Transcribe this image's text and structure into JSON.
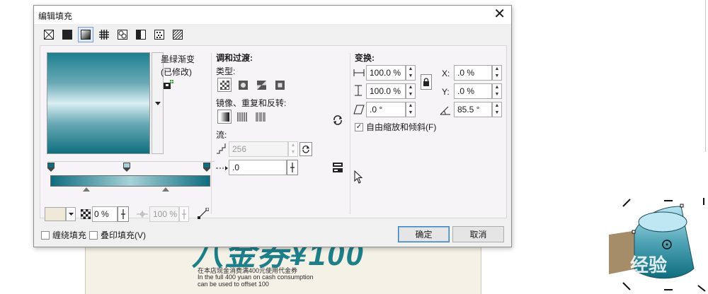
{
  "dialog": {
    "title": "编辑填充",
    "close_label": "✕"
  },
  "fill_types": [
    "none-fill-icon",
    "uniform-fill-icon",
    "fountain-fill-icon",
    "vector-pattern-icon",
    "bitmap-pattern-icon",
    "two-color-pattern-icon",
    "texture-fill-icon",
    "postscript-fill-icon"
  ],
  "preset": {
    "name": "墨绿渐变",
    "modified": "(已修改)"
  },
  "blend": {
    "header": "调和过渡:",
    "type_label": "类型:",
    "mirror_label": "镜像、重复和反转:",
    "flow_label": "流:",
    "steps_value": "256",
    "accel_value": ".0"
  },
  "transform": {
    "header": "变换:",
    "width_value": "100.0 %",
    "height_value": "100.0 %",
    "skew_value": ".0 °",
    "x_label": "X:",
    "x_value": ".0 %",
    "y_label": "Y:",
    "y_value": ".0 %",
    "rotate_value": "85.5 °",
    "free_scale_label": "自由缩放和倾斜(F)",
    "free_scale_checked": true
  },
  "node": {
    "transparency_value": "0 %",
    "position_value": "100 %"
  },
  "footer": {
    "wrap_fill_label": "缠绕填充",
    "overprint_label": "叠印填充(V)",
    "ok_label": "确定",
    "cancel_label": "取消"
  },
  "background": {
    "poster_big": "八金券¥100",
    "poster_line1": "在本店现金消费满400元使用代金券",
    "poster_line2": "In the full 400 yuan on cash consumption",
    "poster_line3": "can be used to offset 100",
    "watermark": "经验"
  },
  "colors": {
    "accent": "#1e7f90",
    "default_button_border": "#3c7fb1"
  }
}
